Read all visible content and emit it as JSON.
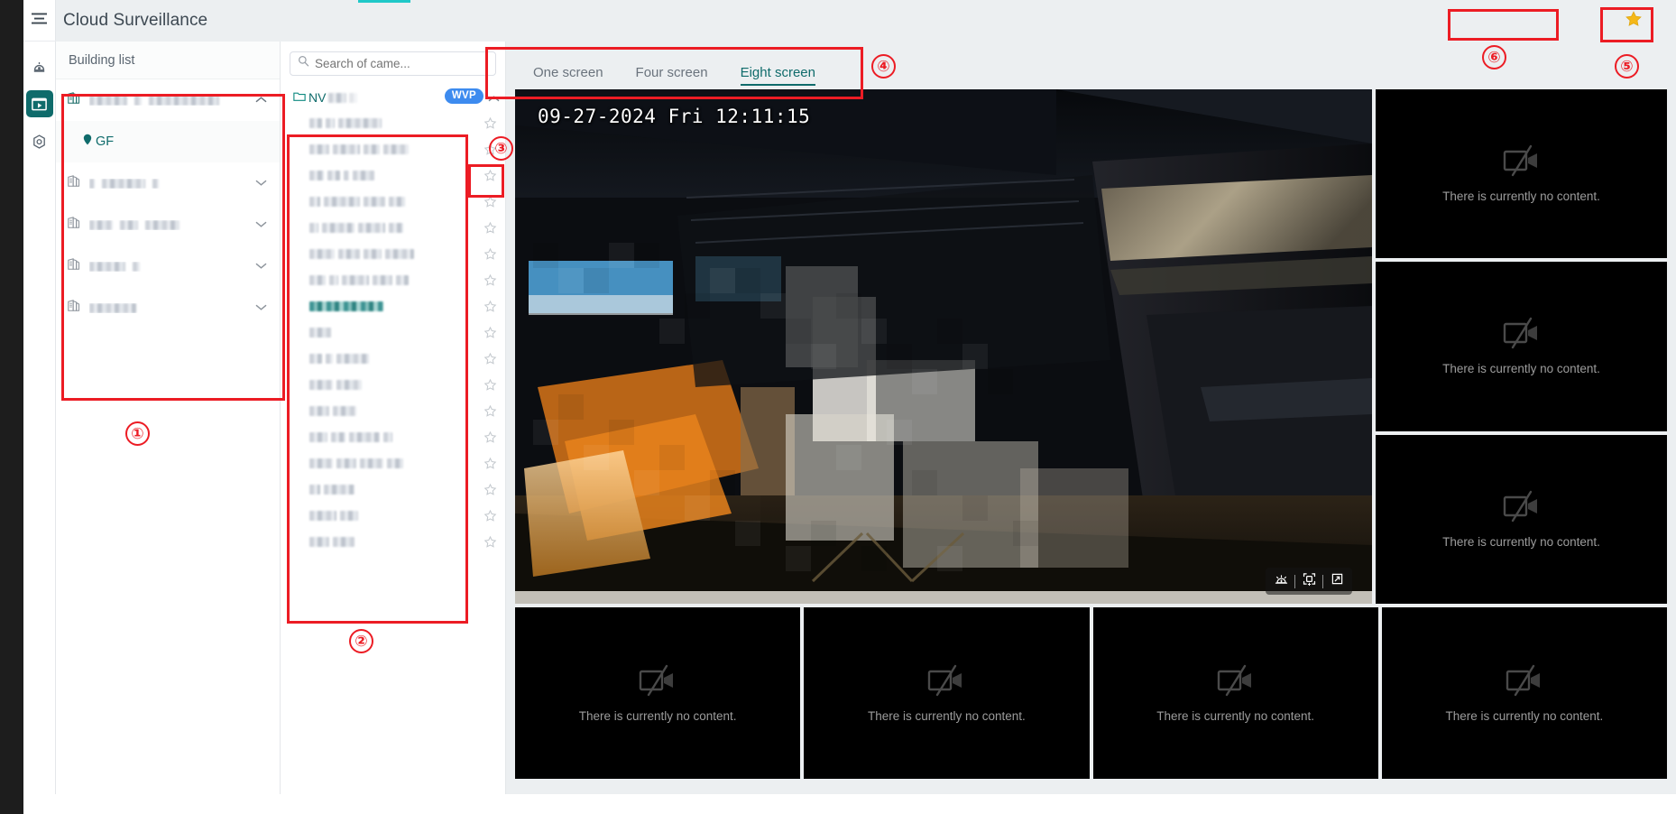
{
  "header": {
    "title": "Cloud Surveillance",
    "burger_icon": "hamburger-menu-icon",
    "star_icon": "star-filled-icon",
    "accent": "#0f6b6b",
    "teal_tick": "#1fc8c8"
  },
  "rail": {
    "items": [
      {
        "icon": "alarm-siren-icon",
        "active": false
      },
      {
        "icon": "video-monitor-icon",
        "active": true
      },
      {
        "icon": "settings-hex-icon",
        "active": false
      }
    ]
  },
  "building_panel": {
    "header_label": "Building list",
    "rows": [
      {
        "icon": "building-icon",
        "label": "",
        "redacted": true,
        "redacted_widths": [
          42,
          8,
          78
        ],
        "expanded": true,
        "selected": true
      },
      {
        "icon": "location-pin-icon",
        "label": "GF",
        "redacted": false,
        "child": true
      },
      {
        "icon": "building-icon",
        "label": "",
        "redacted": true,
        "redacted_widths": [
          6,
          48,
          7
        ],
        "expanded": false
      },
      {
        "icon": "building-icon",
        "label": "",
        "redacted": true,
        "redacted_widths": [
          26,
          20,
          38
        ],
        "expanded": false
      },
      {
        "icon": "building-icon",
        "label": "",
        "redacted": true,
        "redacted_widths": [
          40,
          8
        ],
        "expanded": false
      },
      {
        "icon": "building-icon",
        "label": "",
        "redacted": true,
        "redacted_widths": [
          52
        ],
        "expanded": false
      }
    ]
  },
  "camera_panel": {
    "search": {
      "placeholder": "Search of came...",
      "value": "",
      "icon": "search-icon"
    },
    "group": {
      "icon": "folder-icon",
      "label_visible": "NV",
      "redacted_widths": [
        20,
        10
      ],
      "badge": "WVP",
      "badge_color": "#3d8bef",
      "collapse_icon": "chevron-up-icon"
    },
    "star_icon": "star-outline-icon",
    "cameras": [
      {
        "redacted_widths": [
          14,
          10,
          48
        ],
        "teal": false
      },
      {
        "redacted_widths": [
          22,
          30,
          18,
          28
        ],
        "teal": false
      },
      {
        "redacted_widths": [
          16,
          14,
          6,
          24
        ],
        "teal": false
      },
      {
        "redacted_widths": [
          12,
          40,
          24,
          18
        ],
        "teal": false
      },
      {
        "redacted_widths": [
          10,
          36,
          30,
          16
        ],
        "teal": false
      },
      {
        "redacted_widths": [
          28,
          24,
          20,
          32
        ],
        "teal": false
      },
      {
        "redacted_widths": [
          18,
          10,
          30,
          22,
          14
        ],
        "teal": false
      },
      {
        "redacted_widths": [
          82
        ],
        "teal": true
      },
      {
        "redacted_widths": [
          24
        ],
        "teal": false
      },
      {
        "redacted_widths": [
          14,
          8,
          36
        ],
        "teal": false
      },
      {
        "redacted_widths": [
          26,
          28
        ],
        "teal": false
      },
      {
        "redacted_widths": [
          22,
          26
        ],
        "teal": false
      },
      {
        "redacted_widths": [
          20,
          16,
          34,
          10
        ],
        "teal": false
      },
      {
        "redacted_widths": [
          26,
          22,
          26,
          18
        ],
        "teal": false
      },
      {
        "redacted_widths": [
          12,
          34
        ],
        "teal": false
      },
      {
        "redacted_widths": [
          30,
          20
        ],
        "teal": false
      },
      {
        "redacted_widths": [
          22,
          24
        ],
        "teal": false
      }
    ]
  },
  "video": {
    "tabs": [
      {
        "label": "One screen",
        "active": false
      },
      {
        "label": "Four screen",
        "active": false
      },
      {
        "label": "Eight screen",
        "active": true
      }
    ],
    "live": {
      "timestamp": "09-27-2024 Fri 12:11:15",
      "controls": [
        {
          "icon": "alarm-siren-icon"
        },
        {
          "icon": "snapshot-capture-icon"
        },
        {
          "icon": "fullscreen-expand-icon"
        }
      ]
    },
    "empty_cell": {
      "text": "There is currently no content.",
      "icon": "camera-off-icon"
    },
    "side_cells": 3,
    "bottom_cells": 4
  },
  "annotations": [
    {
      "num": "①"
    },
    {
      "num": "②"
    },
    {
      "num": "③"
    },
    {
      "num": "④"
    },
    {
      "num": "⑤"
    },
    {
      "num": "⑥"
    }
  ]
}
